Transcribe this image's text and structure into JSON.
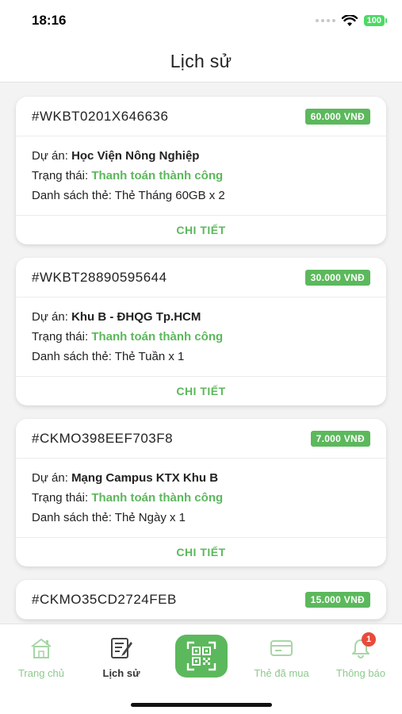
{
  "status_bar": {
    "time": "18:16",
    "battery": "100"
  },
  "header": {
    "title": "Lịch sử"
  },
  "labels": {
    "project": "Dự án: ",
    "status": "Trạng thái: ",
    "cards": "Danh sách thẻ: ",
    "detail": "CHI TIẾT"
  },
  "orders": [
    {
      "id": "#WKBT0201X646636",
      "amount": "60.000 VNĐ",
      "project": "Học Viện Nông Nghiệp",
      "status": "Thanh toán thành công",
      "cards": "Thẻ Tháng 60GB x 2"
    },
    {
      "id": "#WKBT28890595644",
      "amount": "30.000 VNĐ",
      "project": "Khu B - ĐHQG Tp.HCM",
      "status": "Thanh toán thành công",
      "cards": "Thẻ Tuần x 1"
    },
    {
      "id": "#CKMO398EEF703F8",
      "amount": "7.000 VNĐ",
      "project": "Mạng Campus KTX Khu B",
      "status": "Thanh toán thành công",
      "cards": "Thẻ Ngày x 1"
    },
    {
      "id": "#CKMO35CD2724FEB",
      "amount": "15.000 VNĐ"
    }
  ],
  "nav": {
    "home": "Trang chủ",
    "history": "Lịch sử",
    "purchased": "Thẻ đã mua",
    "notifications": "Thông báo",
    "badge_count": "1"
  },
  "colors": {
    "accent": "#5cb85c",
    "badge": "#e74c3c",
    "inactive_nav": "#8ec98e"
  },
  "icons": [
    "wifi-icon",
    "battery-icon",
    "home-icon",
    "history-icon",
    "qr-scan-icon",
    "card-icon",
    "bell-icon"
  ]
}
